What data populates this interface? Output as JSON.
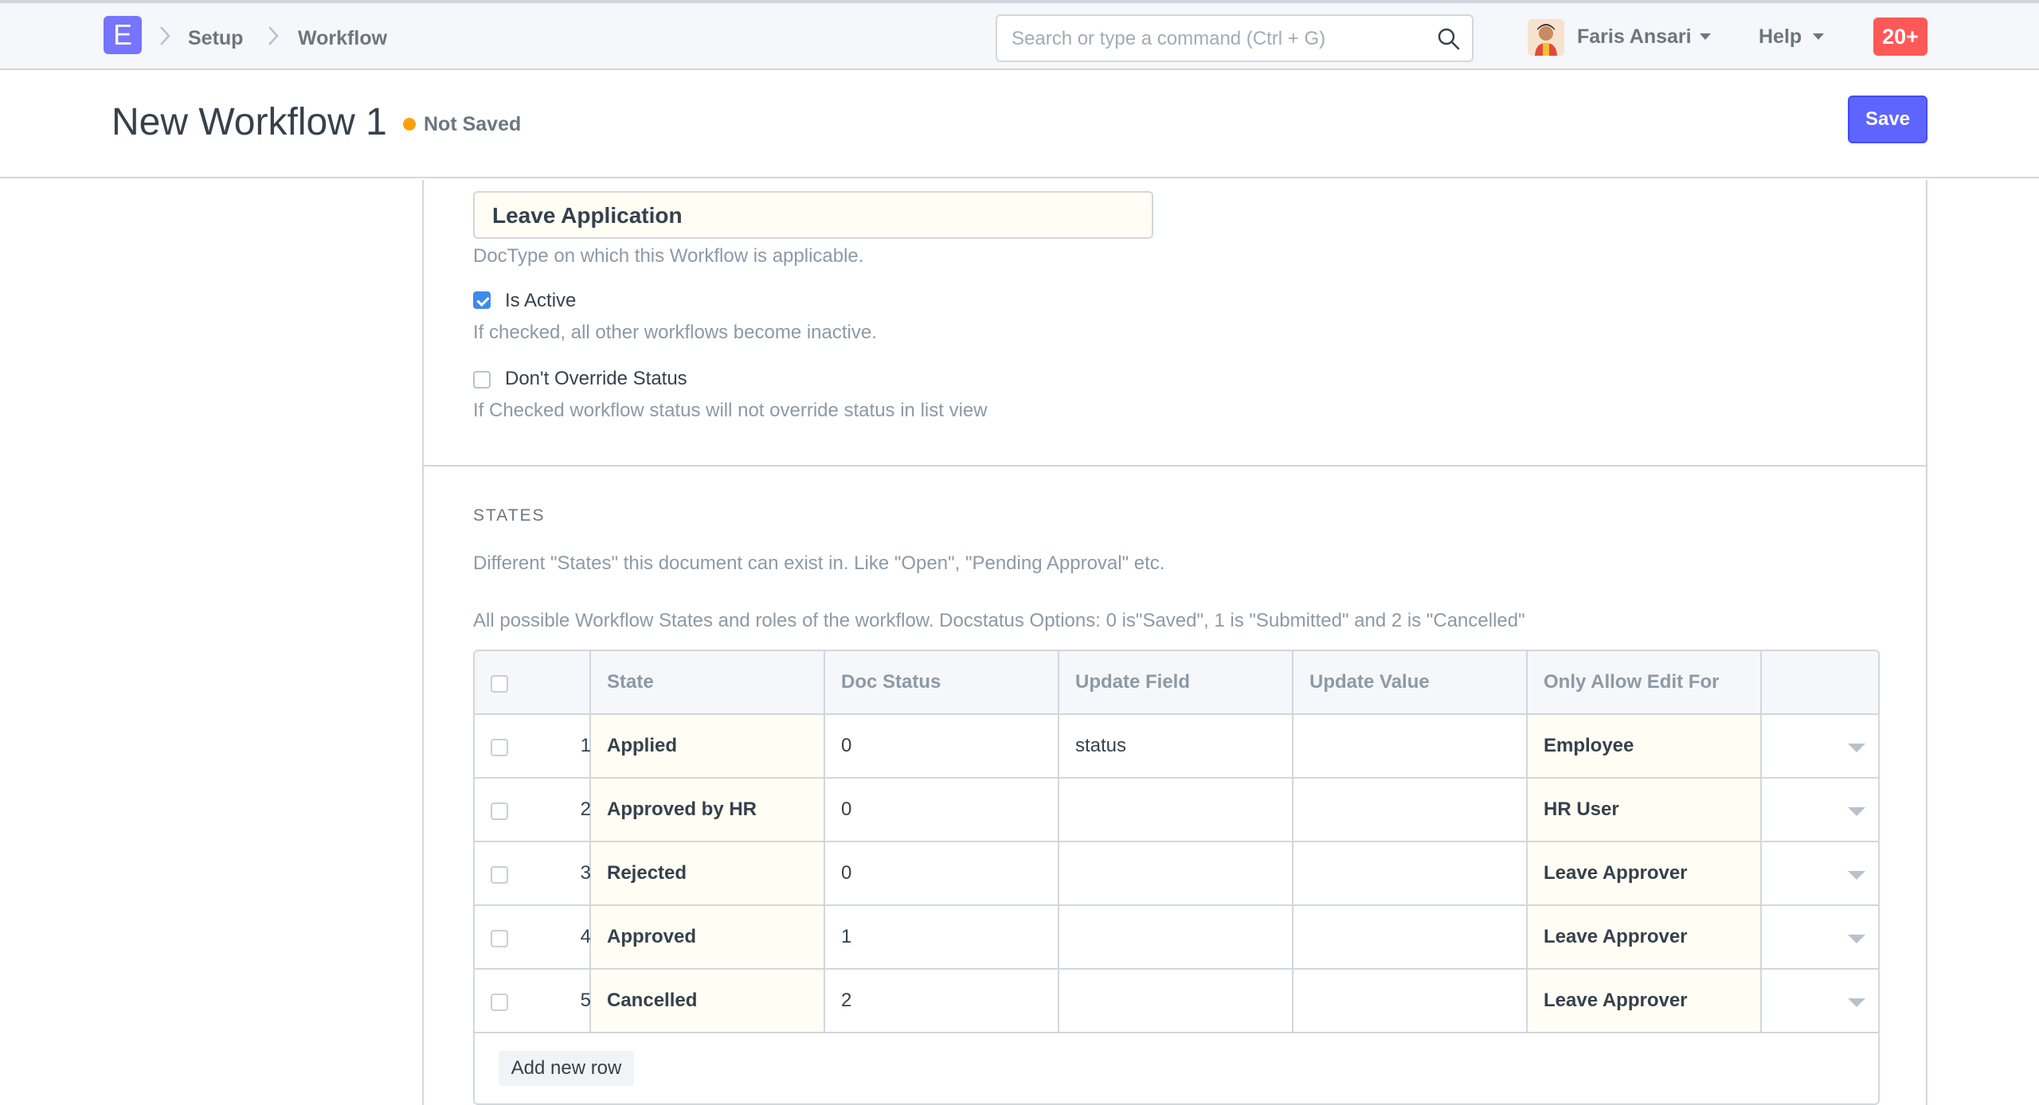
{
  "navbar": {
    "logo_letter": "E",
    "breadcrumbs": [
      "Setup",
      "Workflow"
    ],
    "search_placeholder": "Search or type a command (Ctrl + G)",
    "user_name": "Faris Ansari",
    "help_label": "Help",
    "notification_count": "20+"
  },
  "page": {
    "title": "New Workflow 1",
    "status": "Not Saved",
    "save_label": "Save"
  },
  "form": {
    "document_type_value": "Leave Application",
    "document_type_help": "DocType on which this Workflow is applicable.",
    "is_active_label": "Is Active",
    "is_active_checked": true,
    "is_active_help": "If checked, all other workflows become inactive.",
    "dont_override_label": "Don't Override Status",
    "dont_override_checked": false,
    "dont_override_help": "If Checked workflow status will not override status in list view"
  },
  "states_section": {
    "heading": "STATES",
    "description": "Different \"States\" this document can exist in. Like \"Open\", \"Pending Approval\" etc.",
    "grid_description": "All possible Workflow States and roles of the workflow. Docstatus Options: 0 is\"Saved\", 1 is \"Submitted\" and 2 is \"Cancelled\"",
    "columns": [
      "State",
      "Doc Status",
      "Update Field",
      "Update Value",
      "Only Allow Edit For"
    ],
    "rows": [
      {
        "idx": "1",
        "state": "Applied",
        "doc_status": "0",
        "update_field": "status",
        "update_value": "",
        "allow_edit_for": "Employee"
      },
      {
        "idx": "2",
        "state": "Approved by HR",
        "doc_status": "0",
        "update_field": "",
        "update_value": "",
        "allow_edit_for": "HR User"
      },
      {
        "idx": "3",
        "state": "Rejected",
        "doc_status": "0",
        "update_field": "",
        "update_value": "",
        "allow_edit_for": "Leave Approver"
      },
      {
        "idx": "4",
        "state": "Approved",
        "doc_status": "1",
        "update_field": "",
        "update_value": "",
        "allow_edit_for": "Leave Approver"
      },
      {
        "idx": "5",
        "state": "Cancelled",
        "doc_status": "2",
        "update_field": "",
        "update_value": "",
        "allow_edit_for": "Leave Approver"
      }
    ],
    "add_row_label": "Add new row"
  },
  "colors": {
    "brand": "#7575ff",
    "primary_button": "#5e64ff",
    "not_saved_indicator": "#ffa00a",
    "notification_badge": "#ff5858",
    "checkbox_checked": "#3e8be8"
  },
  "icons": [
    "app-logo",
    "breadcrumb-chevron-icon",
    "search-icon",
    "user-avatar",
    "caret-down-icon",
    "row-dropdown-caret-icon",
    "checkbox"
  ]
}
